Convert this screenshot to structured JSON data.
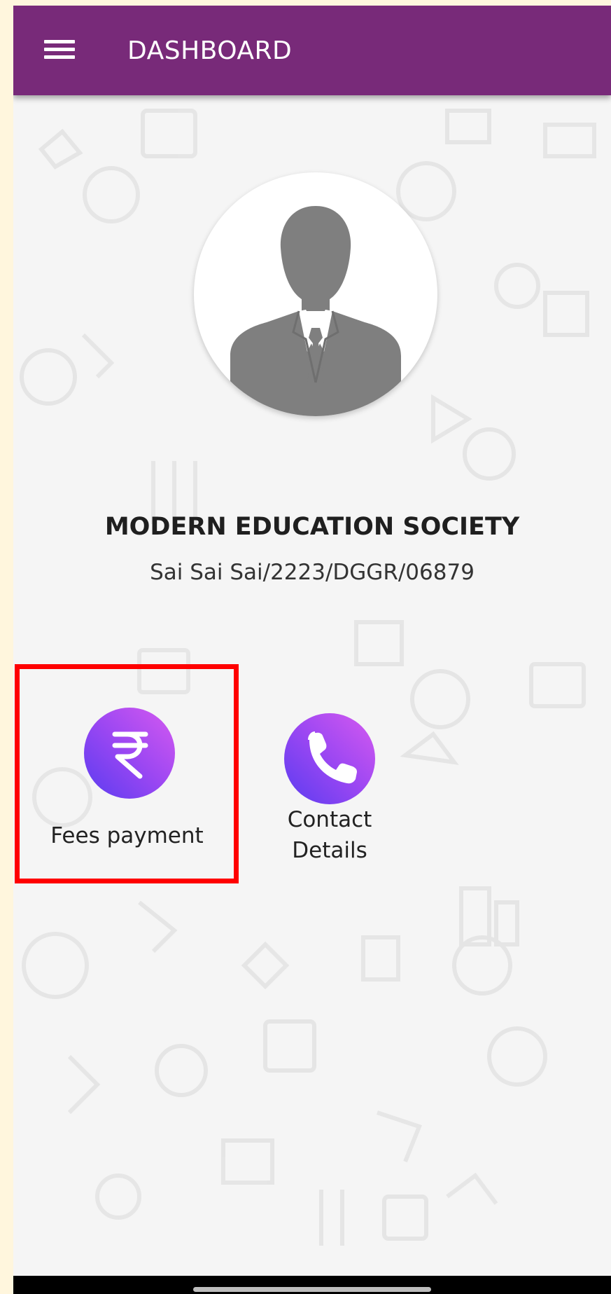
{
  "appbar": {
    "title": "DASHBOARD",
    "menu_icon": "hamburger-menu-icon",
    "background_color": "#782a79"
  },
  "profile": {
    "avatar_icon": "person-silhouette-icon",
    "org_name": "MODERN EDUCATION SOCIETY",
    "org_code": "Sai Sai Sai/2223/DGGR/06879"
  },
  "tiles": [
    {
      "id": "fees",
      "label": "Fees payment",
      "icon": "rupee-icon",
      "highlighted": true
    },
    {
      "id": "contact",
      "label": "Contact\nDetails",
      "icon": "phone-icon",
      "highlighted": false
    }
  ],
  "colors": {
    "accent_gradient_start": "#d65af0",
    "accent_gradient_end": "#5a3cf0",
    "highlight": "#ff0000",
    "page_background": "#f5f5f5"
  }
}
